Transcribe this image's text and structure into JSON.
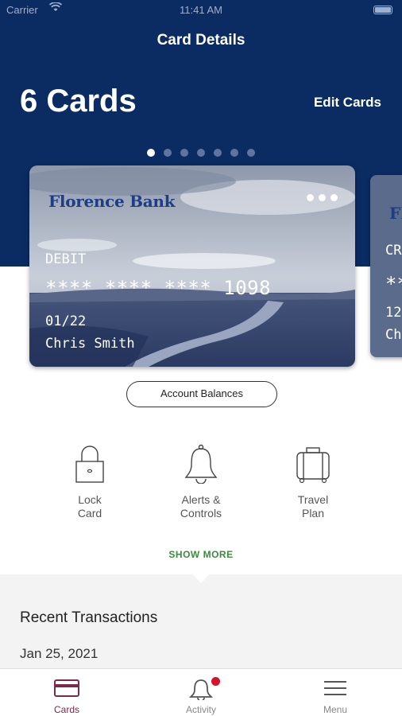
{
  "status_bar": {
    "carrier": "Carrier",
    "time": "11:41 AM"
  },
  "header": {
    "title": "Card Details",
    "card_count": "6 Cards",
    "edit_label": "Edit Cards"
  },
  "pager": {
    "total": 7,
    "active_index": 0
  },
  "cards": [
    {
      "bank": "Florence Bank",
      "type": "DEBIT",
      "number": "**** **** **** 1098",
      "expiry": "01/22",
      "holder": "Chris Smith"
    },
    {
      "bank": "Fl",
      "type": "CR",
      "number": "**",
      "expiry": "12",
      "holder": "Ch"
    }
  ],
  "account_balances_label": "Account Balances",
  "actions": [
    {
      "icon": "lock-icon",
      "label": "Lock\nCard"
    },
    {
      "icon": "bell-icon",
      "label": "Alerts &\nControls"
    },
    {
      "icon": "suitcase-icon",
      "label": "Travel\nPlan"
    }
  ],
  "show_more_label": "SHOW MORE",
  "transactions": {
    "title": "Recent Transactions",
    "first_date": "Jan 25, 2021"
  },
  "tabs": [
    {
      "label": "Cards",
      "icon": "card-icon",
      "active": true
    },
    {
      "label": "Activity",
      "icon": "bell-icon",
      "badge": true
    },
    {
      "label": "Menu",
      "icon": "hamburger-icon"
    }
  ],
  "colors": {
    "brand_navy": "#0b2b63",
    "accent_green": "#3c8a3c",
    "active_tab": "#7a2a4b",
    "badge_red": "#d4122a"
  }
}
